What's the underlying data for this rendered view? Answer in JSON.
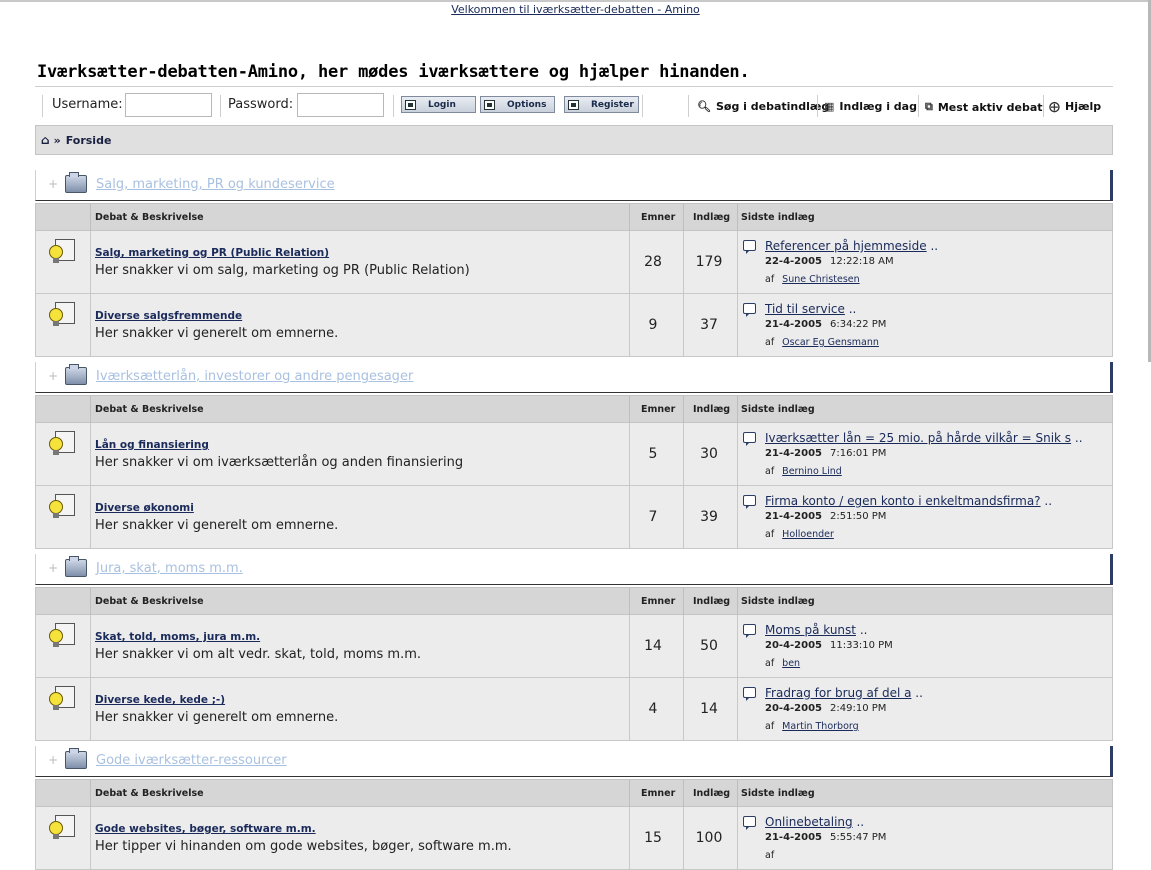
{
  "header": {
    "welcome_link": "Velkommen til iværksætter-debatten - Amino",
    "page_title": "Iværksætter-debatten-Amino, her mødes iværksættere og hjælper hinanden."
  },
  "login": {
    "username_label": "Username:",
    "password_label": "Password:",
    "username_value": "",
    "password_value": "",
    "login_button": "Login",
    "options_button": "Options",
    "register_button": "Register"
  },
  "toolbar_links": {
    "search": "Søg i debatindlæg",
    "today": "Indlæg i dag",
    "most_active": "Mest aktiv debat",
    "help": "Hjælp"
  },
  "breadcrumb": {
    "home_icon": "home-icon",
    "separator": "»",
    "current": "Forside"
  },
  "columns": {
    "debate": "Debat & Beskrivelse",
    "topics": "Emner",
    "posts": "Indlæg",
    "last": "Sidste indlæg"
  },
  "categories": [
    {
      "title": "Salg, marketing, PR og kundeservice",
      "forums": [
        {
          "name": "Salg, marketing og PR (Public Relation)",
          "desc": "Her snakker vi om salg, marketing og PR (Public Relation)",
          "topics": "28",
          "posts": "179",
          "last_title": "Referencer på hjemmeside",
          "last_suffix": "..",
          "last_date": "22-4-2005",
          "last_time": "12:22:18 AM",
          "by_label": "af",
          "last_user": "Sune Christesen"
        },
        {
          "name": "Diverse salgsfremmende",
          "desc": "Her snakker vi generelt om emnerne.",
          "topics": "9",
          "posts": "37",
          "last_title": "Tid til service",
          "last_suffix": "..",
          "last_date": "21-4-2005",
          "last_time": "6:34:22 PM",
          "by_label": "af",
          "last_user": "Oscar Eg Gensmann"
        }
      ]
    },
    {
      "title": "Iværksætterlån, investorer og andre pengesager",
      "forums": [
        {
          "name": "Lån og finansiering",
          "desc": "Her snakker vi om iværksætterlån og anden finansiering",
          "topics": "5",
          "posts": "30",
          "last_title": "Iværksætter lån = 25 mio. på hårde vilkår = Snik s",
          "last_suffix": "..",
          "last_date": "21-4-2005",
          "last_time": "7:16:01 PM",
          "by_label": "af",
          "last_user": "Bernino Lind"
        },
        {
          "name": "Diverse økonomi",
          "desc": "Her snakker vi generelt om emnerne.",
          "topics": "7",
          "posts": "39",
          "last_title": "Firma konto / egen konto i enkeltmandsfirma?",
          "last_suffix": "..",
          "last_date": "21-4-2005",
          "last_time": "2:51:50 PM",
          "by_label": "af",
          "last_user": "Holloender"
        }
      ]
    },
    {
      "title": "Jura, skat, moms m.m.",
      "forums": [
        {
          "name": "Skat, told, moms, jura m.m.",
          "desc": "Her snakker vi om alt vedr. skat, told, moms m.m.",
          "topics": "14",
          "posts": "50",
          "last_title": "Moms på kunst",
          "last_suffix": "..",
          "last_date": "20-4-2005",
          "last_time": "11:33:10 PM",
          "by_label": "af",
          "last_user": "ben"
        },
        {
          "name": "Diverse kede, kede ;-)",
          "desc": "Her snakker vi generelt om emnerne.",
          "topics": "4",
          "posts": "14",
          "last_title": "Fradrag for brug af del a",
          "last_suffix": "..",
          "last_date": "20-4-2005",
          "last_time": "2:49:10 PM",
          "by_label": "af",
          "last_user": "Martin Thorborg"
        }
      ]
    },
    {
      "title": "Gode iværksætter-ressourcer",
      "forums": [
        {
          "name": "Gode websites, bøger, software m.m.",
          "desc": "Her tipper vi hinanden om gode websites, bøger, software m.m.",
          "topics": "15",
          "posts": "100",
          "last_title": "Onlinebetaling",
          "last_suffix": "..",
          "last_date": "21-4-2005",
          "last_time": "5:55:47 PM",
          "by_label": "af",
          "last_user": ""
        }
      ]
    }
  ]
}
